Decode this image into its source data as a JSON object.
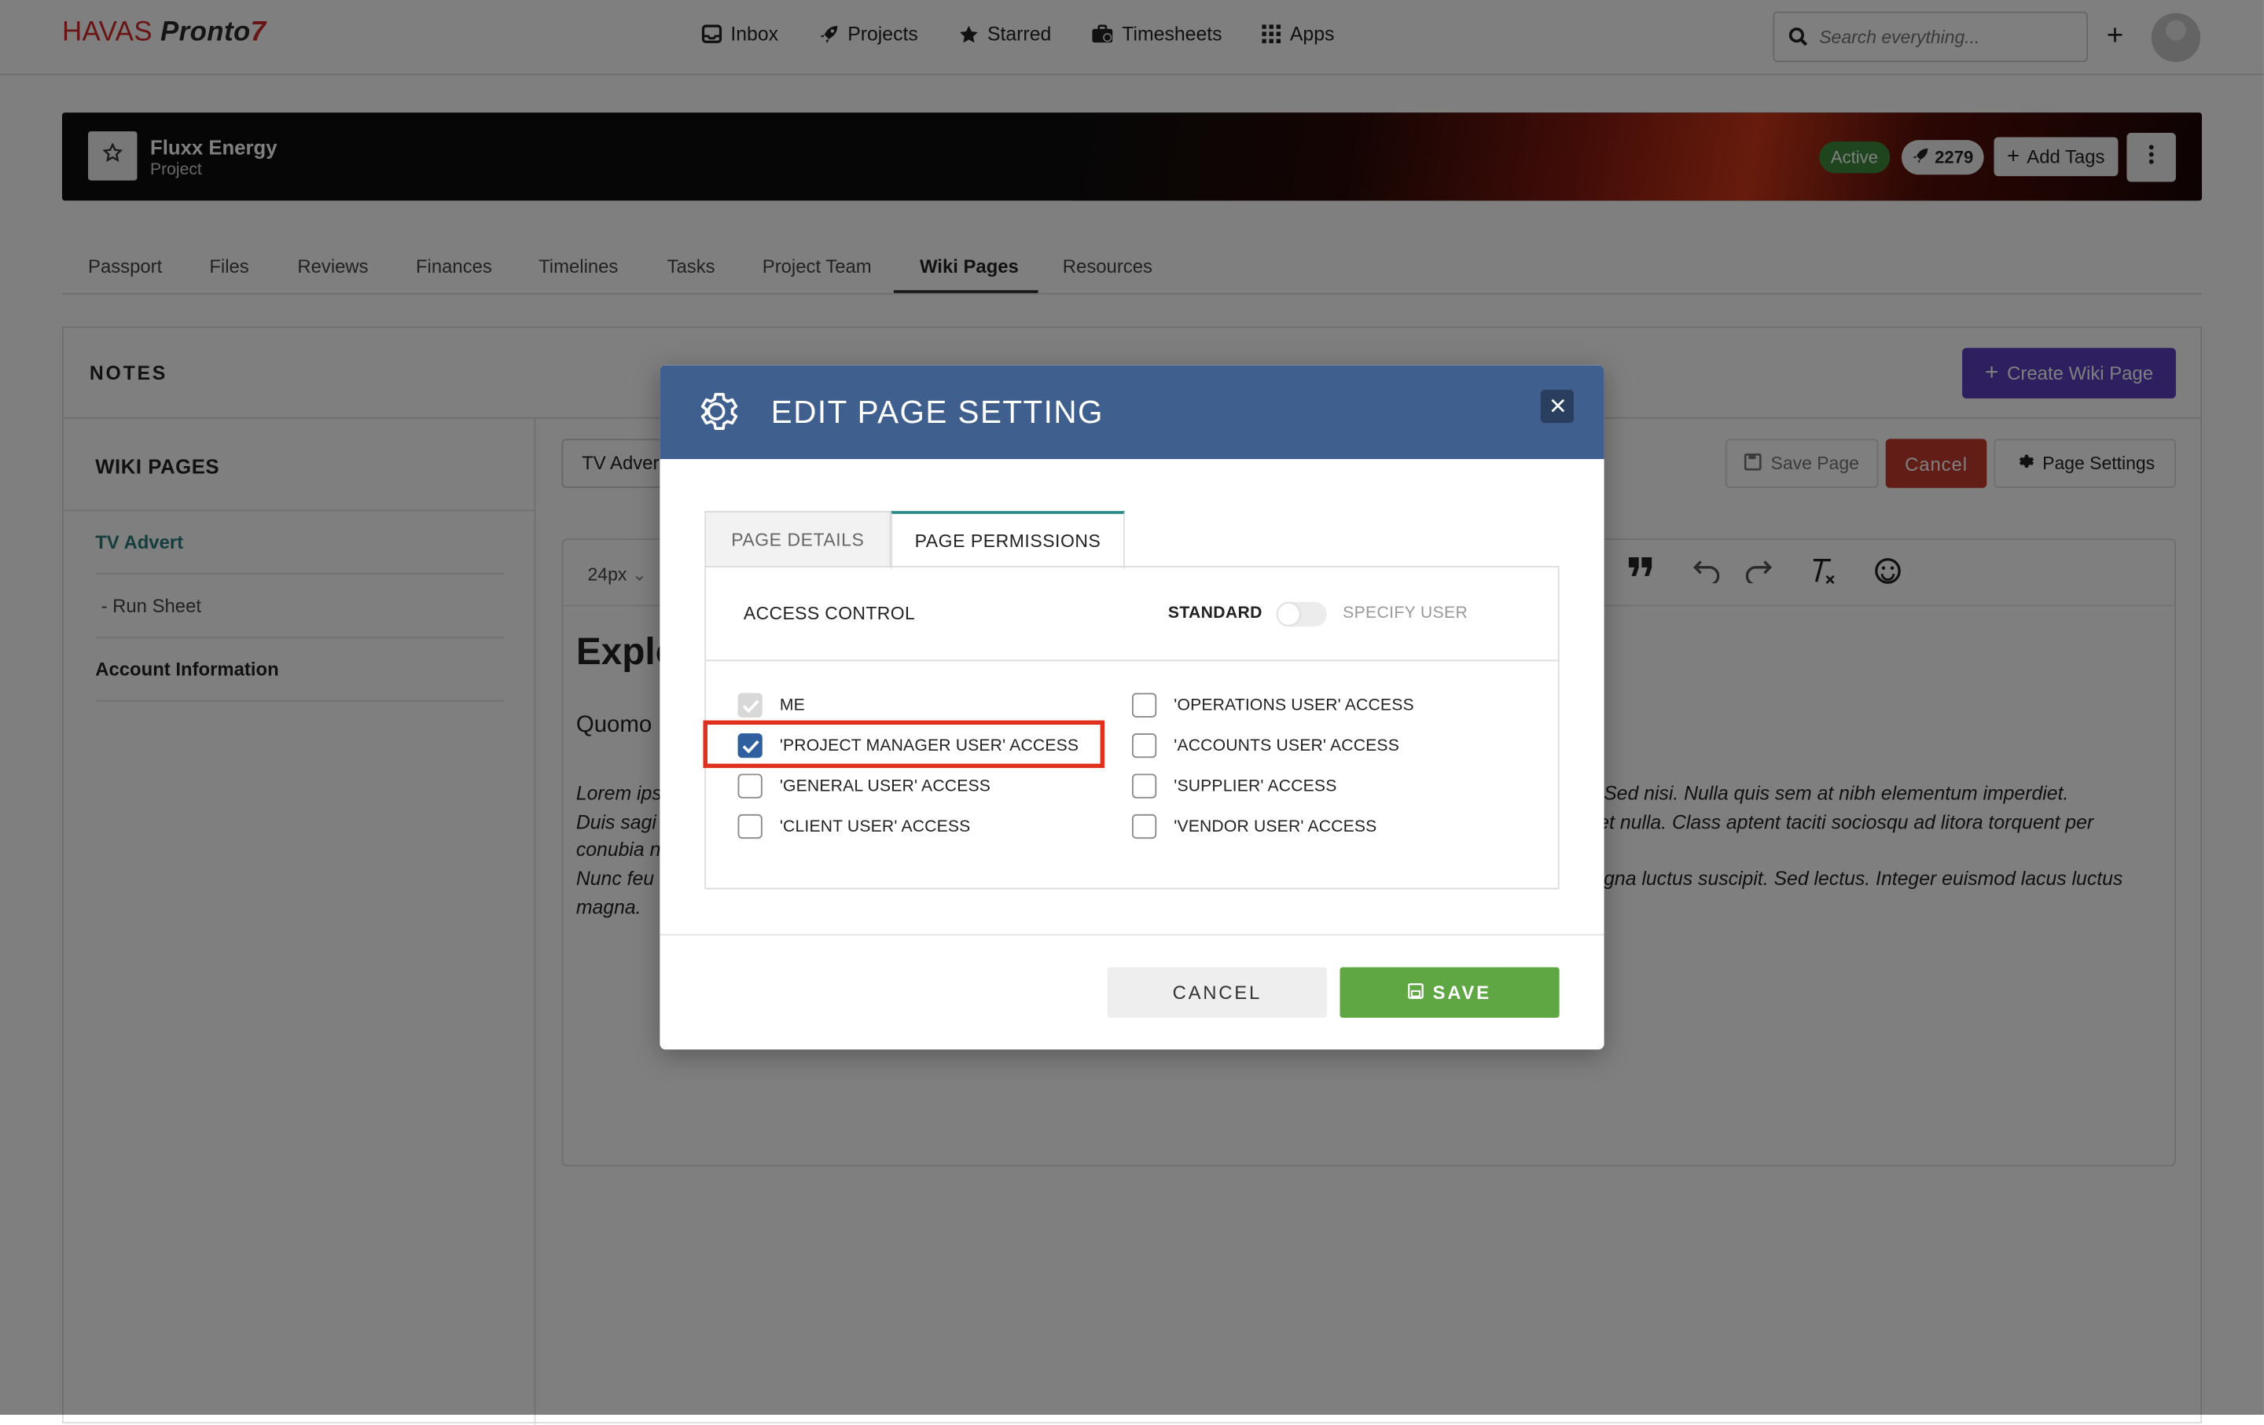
{
  "app": {
    "logo_havas": "HAVAS",
    "logo_pronto": "Pronto",
    "logo_bolt": "7"
  },
  "nav": {
    "items": [
      {
        "label": "Inbox",
        "icon": "inbox-icon"
      },
      {
        "label": "Projects",
        "icon": "rocket-icon"
      },
      {
        "label": "Starred",
        "icon": "star-icon"
      },
      {
        "label": "Timesheets",
        "icon": "briefcase-icon"
      },
      {
        "label": "Apps",
        "icon": "grid-icon"
      }
    ],
    "search_placeholder": "Search everything..."
  },
  "project": {
    "name": "Fluxx Energy",
    "type": "Project",
    "status": "Active",
    "count": "2279",
    "add_tags": "Add Tags"
  },
  "tabs": [
    "Passport",
    "Files",
    "Reviews",
    "Finances",
    "Timelines",
    "Tasks",
    "Project Team",
    "Wiki Pages",
    "Resources"
  ],
  "active_tab": "Wiki Pages",
  "notes": {
    "title": "NOTES",
    "create_button": "Create Wiki Page",
    "sidebar_title": "WIKI PAGES",
    "pages": [
      "TV Advert",
      "- Run Sheet",
      "Account Information"
    ],
    "page_name_value": "TV Advert",
    "save_page": "Save Page",
    "cancel": "Cancel",
    "page_settings": "Page Settings",
    "font_size": "24px",
    "heading": "Explo",
    "subheading": "Quomo",
    "para_left": [
      "Lorem ips",
      "Duis sagi",
      "conubia n",
      "Nunc feu",
      "magna."
    ],
    "para_right": [
      "m. Sed nisi. Nulla quis sem at nibh elementum imperdiet.",
      "eget nulla. Class aptent taciti sociosqu ad litora torquent per",
      "",
      "magna luctus suscipit. Sed lectus. Integer euismod lacus luctus",
      ""
    ]
  },
  "modal": {
    "title": "EDIT PAGE SETTING",
    "tab_details": "PAGE DETAILS",
    "tab_permissions": "PAGE PERMISSIONS",
    "access_control": "ACCESS CONTROL",
    "standard": "STANDARD",
    "specify_user": "SPECIFY USER",
    "left_options": [
      {
        "label": "ME",
        "state": "disabled-checked"
      },
      {
        "label": "'PROJECT MANAGER USER' ACCESS",
        "state": "checked"
      },
      {
        "label": "'GENERAL USER' ACCESS",
        "state": "unchecked"
      },
      {
        "label": "'CLIENT USER' ACCESS",
        "state": "unchecked"
      }
    ],
    "right_options": [
      {
        "label": "'OPERATIONS USER' ACCESS",
        "state": "unchecked"
      },
      {
        "label": "'ACCOUNTS USER' ACCESS",
        "state": "unchecked"
      },
      {
        "label": "'SUPPLIER' ACCESS",
        "state": "unchecked"
      },
      {
        "label": "'VENDOR USER' ACCESS",
        "state": "unchecked"
      }
    ],
    "cancel": "CANCEL",
    "save": "SAVE"
  },
  "colors": {
    "modal_header": "#3f5f8e",
    "save_green": "#5fa742",
    "cancel_red": "#c43a2f",
    "create_purple": "#5b3fc0",
    "highlight_red": "#e0311f",
    "active_green": "#3d8b3d"
  }
}
